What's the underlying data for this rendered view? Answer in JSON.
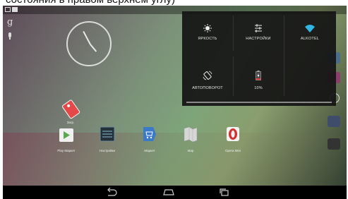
{
  "caption": {
    "text": "состояния в правом верхнем углу)"
  },
  "quick_settings": {
    "brightness_label": "ЯРКОСТЬ",
    "settings_label": "НАСТРОЙКИ",
    "wifi_label": "ALKOTEL",
    "rotation_label": "АВТОПОВОРОТ",
    "battery_label": "10%"
  },
  "desktop": {
    "apps": [
      {
        "name": "Play Маркет"
      },
      {
        "name": "Настройки"
      },
      {
        "name": "Маркет"
      },
      {
        "name": "Map"
      },
      {
        "name": "Opera Mini"
      }
    ],
    "tag_app_label": "Загр."
  },
  "colors": {
    "panel": "#141414",
    "wifi": "#33b5e5",
    "battery": "#e53935",
    "opera": "#d32f2f"
  }
}
